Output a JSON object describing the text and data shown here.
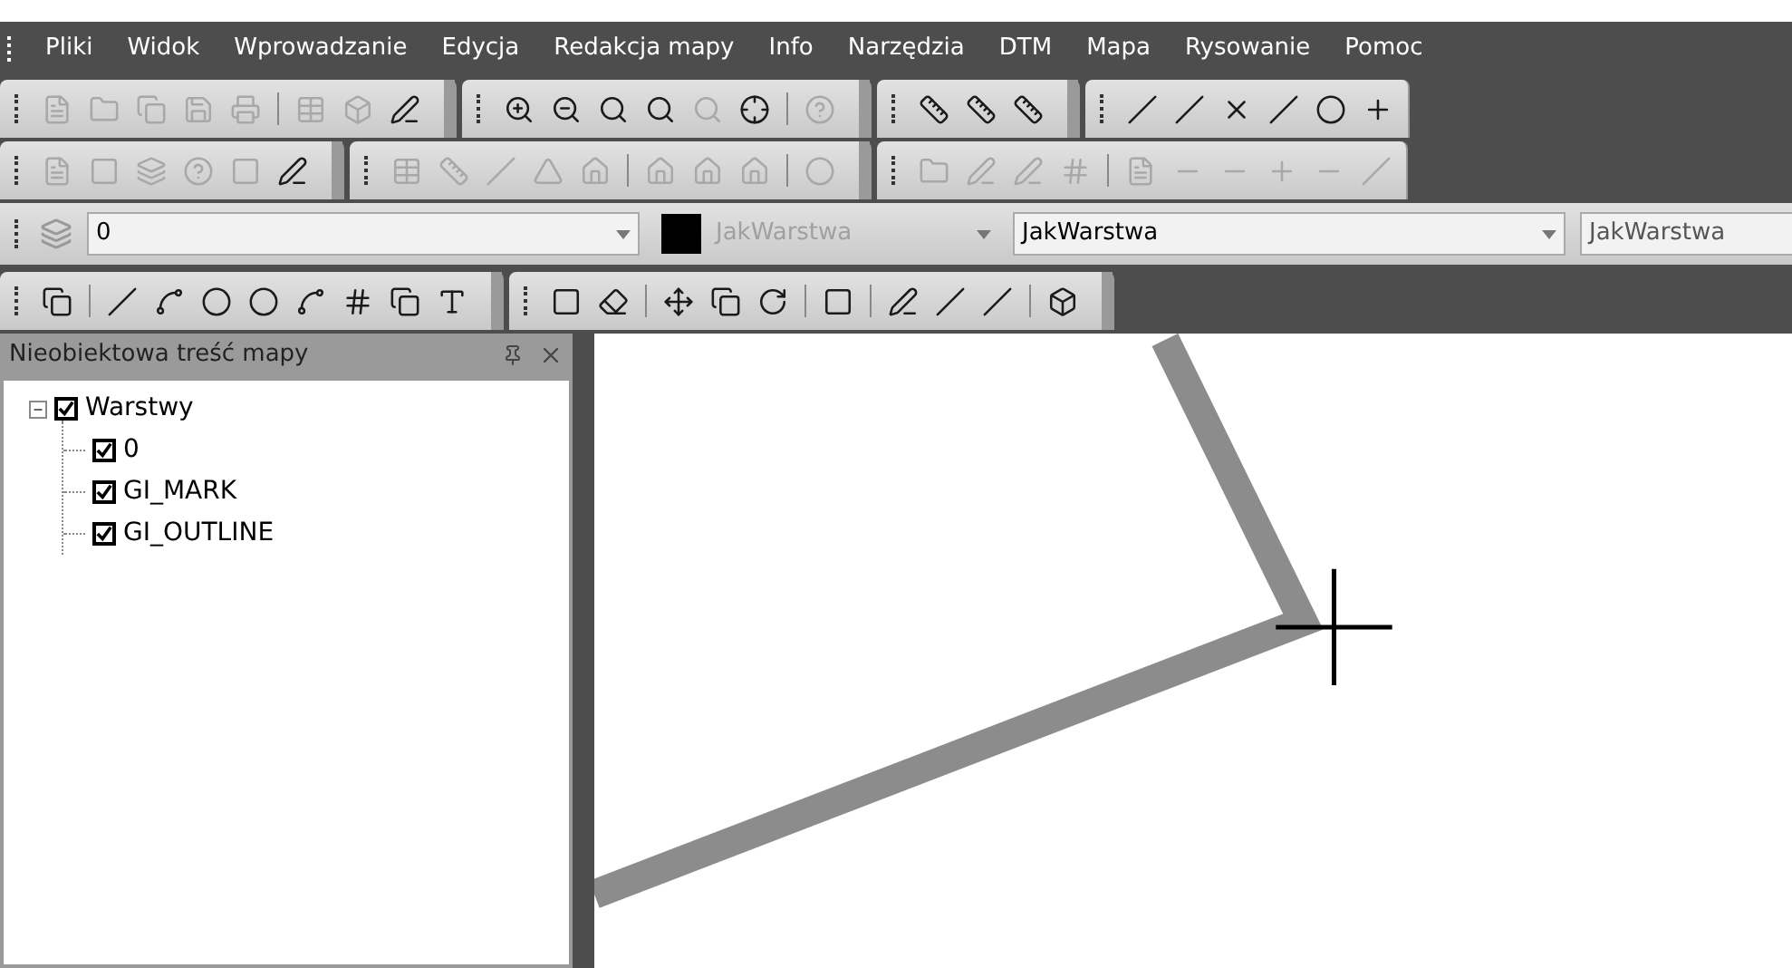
{
  "menu": [
    "Pliki",
    "Widok",
    "Wprowadzanie",
    "Edycja",
    "Redakcja mapy",
    "Info",
    "Narzędzia",
    "DTM",
    "Mapa",
    "Rysowanie",
    "Pomoc"
  ],
  "properties_bar": {
    "layer": "0",
    "color": {
      "value": "JakWarstwa",
      "disabled": true
    },
    "linetype": "JakWarstwa",
    "lineweight": "JakWarstwa"
  },
  "panel": {
    "title": "Nieobiektowa treść mapy",
    "tree": [
      {
        "label": "Warstwy",
        "checked": true,
        "expanded": true,
        "children": [
          {
            "label": "0",
            "checked": true
          },
          {
            "label": "GI_MARK",
            "checked": true
          },
          {
            "label": "GI_OUTLINE",
            "checked": true
          }
        ]
      }
    ]
  }
}
